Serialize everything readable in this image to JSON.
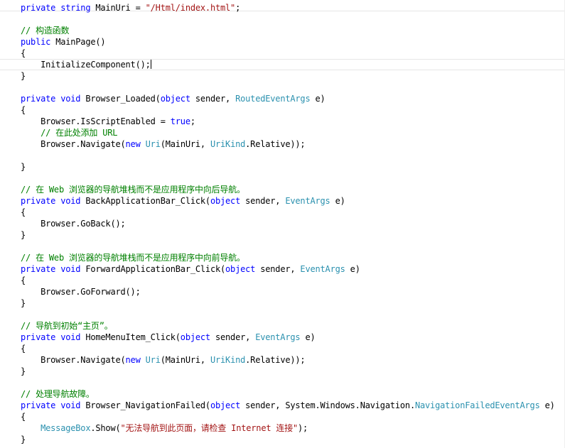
{
  "colors": {
    "keyword": "#0000ff",
    "type": "#2b91af",
    "string": "#a31515",
    "comment": "#008000",
    "plain": "#000000"
  },
  "editor": {
    "lines": [
      [
        {
          "t": "private string ",
          "k": "kw"
        },
        {
          "t": "MainUri = ",
          "k": "plain"
        },
        {
          "t": "\"/Html/index.html\"",
          "k": "str"
        },
        {
          "t": ";",
          "k": "plain"
        }
      ],
      [],
      [
        {
          "t": "// 构造函数",
          "k": "cmt"
        }
      ],
      [
        {
          "t": "public ",
          "k": "kw"
        },
        {
          "t": "MainPage()",
          "k": "plain"
        }
      ],
      [
        {
          "t": "{",
          "k": "plain"
        }
      ],
      [
        {
          "t": "    InitializeComponent();",
          "k": "plain"
        }
      ],
      [
        {
          "t": "}",
          "k": "plain"
        }
      ],
      [],
      [
        {
          "t": "private void ",
          "k": "kw"
        },
        {
          "t": "Browser_Loaded(",
          "k": "plain"
        },
        {
          "t": "object ",
          "k": "kw"
        },
        {
          "t": "sender, ",
          "k": "plain"
        },
        {
          "t": "RoutedEventArgs ",
          "k": "type"
        },
        {
          "t": "e)",
          "k": "plain"
        }
      ],
      [
        {
          "t": "{",
          "k": "plain"
        }
      ],
      [
        {
          "t": "    Browser.IsScriptEnabled = ",
          "k": "plain"
        },
        {
          "t": "true",
          "k": "kw"
        },
        {
          "t": ";",
          "k": "plain"
        }
      ],
      [
        {
          "t": "    // 在此处添加 URL",
          "k": "cmt"
        }
      ],
      [
        {
          "t": "    Browser.Navigate(",
          "k": "plain"
        },
        {
          "t": "new ",
          "k": "kw"
        },
        {
          "t": "Uri",
          "k": "type"
        },
        {
          "t": "(MainUri, ",
          "k": "plain"
        },
        {
          "t": "UriKind",
          "k": "type"
        },
        {
          "t": ".Relative));",
          "k": "plain"
        }
      ],
      [],
      [
        {
          "t": "}",
          "k": "plain"
        }
      ],
      [],
      [
        {
          "t": "// 在 Web 浏览器的导航堆栈而不是应用程序中向后导航。",
          "k": "cmt"
        }
      ],
      [
        {
          "t": "private void ",
          "k": "kw"
        },
        {
          "t": "BackApplicationBar_Click(",
          "k": "plain"
        },
        {
          "t": "object ",
          "k": "kw"
        },
        {
          "t": "sender, ",
          "k": "plain"
        },
        {
          "t": "EventArgs ",
          "k": "type"
        },
        {
          "t": "e)",
          "k": "plain"
        }
      ],
      [
        {
          "t": "{",
          "k": "plain"
        }
      ],
      [
        {
          "t": "    Browser.GoBack();",
          "k": "plain"
        }
      ],
      [
        {
          "t": "}",
          "k": "plain"
        }
      ],
      [],
      [
        {
          "t": "// 在 Web 浏览器的导航堆栈而不是应用程序中向前导航。",
          "k": "cmt"
        }
      ],
      [
        {
          "t": "private void ",
          "k": "kw"
        },
        {
          "t": "ForwardApplicationBar_Click(",
          "k": "plain"
        },
        {
          "t": "object ",
          "k": "kw"
        },
        {
          "t": "sender, ",
          "k": "plain"
        },
        {
          "t": "EventArgs ",
          "k": "type"
        },
        {
          "t": "e)",
          "k": "plain"
        }
      ],
      [
        {
          "t": "{",
          "k": "plain"
        }
      ],
      [
        {
          "t": "    Browser.GoForward();",
          "k": "plain"
        }
      ],
      [
        {
          "t": "}",
          "k": "plain"
        }
      ],
      [],
      [
        {
          "t": "// 导航到初始“主页”。",
          "k": "cmt"
        }
      ],
      [
        {
          "t": "private void ",
          "k": "kw"
        },
        {
          "t": "HomeMenuItem_Click(",
          "k": "plain"
        },
        {
          "t": "object ",
          "k": "kw"
        },
        {
          "t": "sender, ",
          "k": "plain"
        },
        {
          "t": "EventArgs ",
          "k": "type"
        },
        {
          "t": "e)",
          "k": "plain"
        }
      ],
      [
        {
          "t": "{",
          "k": "plain"
        }
      ],
      [
        {
          "t": "    Browser.Navigate(",
          "k": "plain"
        },
        {
          "t": "new ",
          "k": "kw"
        },
        {
          "t": "Uri",
          "k": "type"
        },
        {
          "t": "(MainUri, ",
          "k": "plain"
        },
        {
          "t": "UriKind",
          "k": "type"
        },
        {
          "t": ".Relative));",
          "k": "plain"
        }
      ],
      [
        {
          "t": "}",
          "k": "plain"
        }
      ],
      [],
      [
        {
          "t": "// 处理导航故障。",
          "k": "cmt"
        }
      ],
      [
        {
          "t": "private void ",
          "k": "kw"
        },
        {
          "t": "Browser_NavigationFailed(",
          "k": "plain"
        },
        {
          "t": "object ",
          "k": "kw"
        },
        {
          "t": "sender, System.Windows.Navigation.",
          "k": "plain"
        },
        {
          "t": "NavigationFailedEventArgs ",
          "k": "type"
        },
        {
          "t": "e)",
          "k": "plain"
        }
      ],
      [
        {
          "t": "{",
          "k": "plain"
        }
      ],
      [
        {
          "t": "    ",
          "k": "plain"
        },
        {
          "t": "MessageBox",
          "k": "type"
        },
        {
          "t": ".Show(",
          "k": "plain"
        },
        {
          "t": "\"无法导航到此页面，请检查 Internet 连接\"",
          "k": "str"
        },
        {
          "t": ");",
          "k": "plain"
        }
      ],
      [
        {
          "t": "}",
          "k": "plain"
        }
      ]
    ]
  }
}
